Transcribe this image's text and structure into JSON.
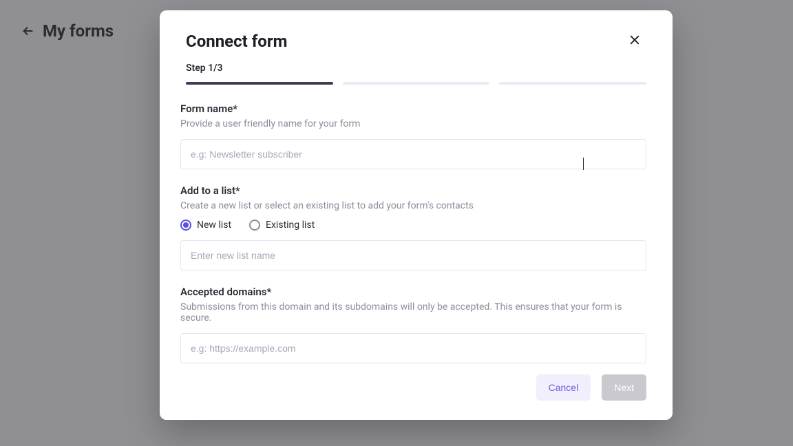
{
  "page": {
    "title": "My forms"
  },
  "modal": {
    "title": "Connect form",
    "step_label": "Step 1/3",
    "progress": {
      "total": 3,
      "current": 1
    },
    "fields": {
      "form_name": {
        "label": "Form name*",
        "help": "Provide a user friendly name for your form",
        "placeholder": "e.g: Newsletter subscriber",
        "value": ""
      },
      "add_to_list": {
        "label": "Add to a list*",
        "help": "Create a new list or select an existing list to add your form's contacts",
        "options": {
          "new": "New list",
          "existing": "Existing list"
        },
        "selected": "new",
        "new_list_placeholder": "Enter new list name",
        "new_list_value": ""
      },
      "accepted_domains": {
        "label": "Accepted domains*",
        "help": "Submissions from this domain and its subdomains will only be accepted. This ensures that your form is secure.",
        "placeholder": "e.g: https://example.com",
        "value": ""
      }
    },
    "buttons": {
      "cancel": "Cancel",
      "next": "Next"
    }
  }
}
